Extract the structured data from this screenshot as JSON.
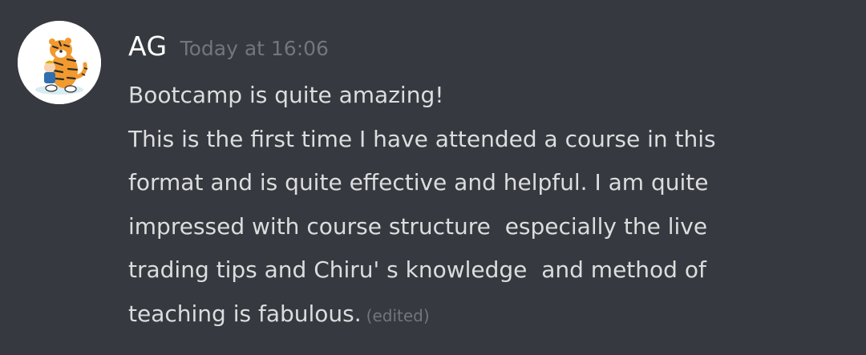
{
  "message": {
    "username": "AG",
    "timestamp": "Today at 16:06",
    "lines": [
      "Bootcamp is quite amazing!",
      "This is the first time I have attended a course in this",
      "format and is quite effective and helpful. I am quite",
      "impressed with course structure  especially the live",
      "trading tips and Chiru' s knowledge  and method of",
      "teaching is fabulous."
    ],
    "edited_label": "(edited)"
  },
  "colors": {
    "background": "#36393f",
    "username": "#ffffff",
    "text": "#dcddde",
    "muted": "#72767d"
  },
  "icons": {
    "avatar": "cartoon-tiger-avatar"
  }
}
